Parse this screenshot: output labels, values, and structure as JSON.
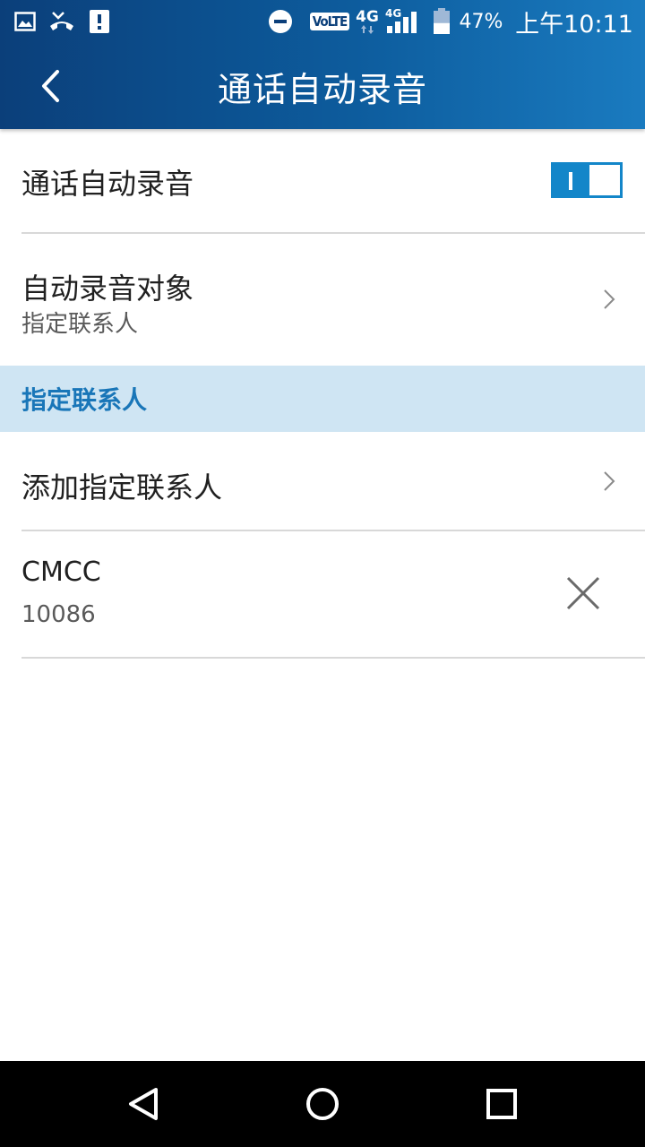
{
  "status_bar": {
    "icons": [
      "image-icon",
      "missed-call-icon",
      "alert-icon",
      "do-not-disturb-icon",
      "volte-icon",
      "network-4g-icon",
      "signal-icon",
      "battery-icon"
    ],
    "volte_label": "VoLTE",
    "network_label": "4G",
    "signal_network_label": "4G",
    "battery": "47%",
    "battery_level": 0.47,
    "time": "上午10:11"
  },
  "toolbar": {
    "back_icon": "back-arrow-icon",
    "title": "通话自动录音"
  },
  "settings": {
    "auto_record": {
      "label": "通话自动录音",
      "enabled": true
    },
    "record_target": {
      "label": "自动录音对象",
      "value": "指定联系人",
      "icon": "chevron-right-icon"
    }
  },
  "section": {
    "header": "指定联系人"
  },
  "contacts": {
    "add_label": "添加指定联系人",
    "items": [
      {
        "name": "CMCC",
        "number": "10086",
        "remove_icon": "close-icon"
      }
    ]
  },
  "colors": {
    "appbar_start": "#0b3f7a",
    "appbar_end": "#1a7bc0",
    "accent": "#1386c9",
    "section_bg": "#cfe5f3",
    "section_text": "#1976b8"
  },
  "nav_bar": {
    "buttons": [
      "back-triangle-icon",
      "home-circle-icon",
      "recents-square-icon"
    ]
  }
}
